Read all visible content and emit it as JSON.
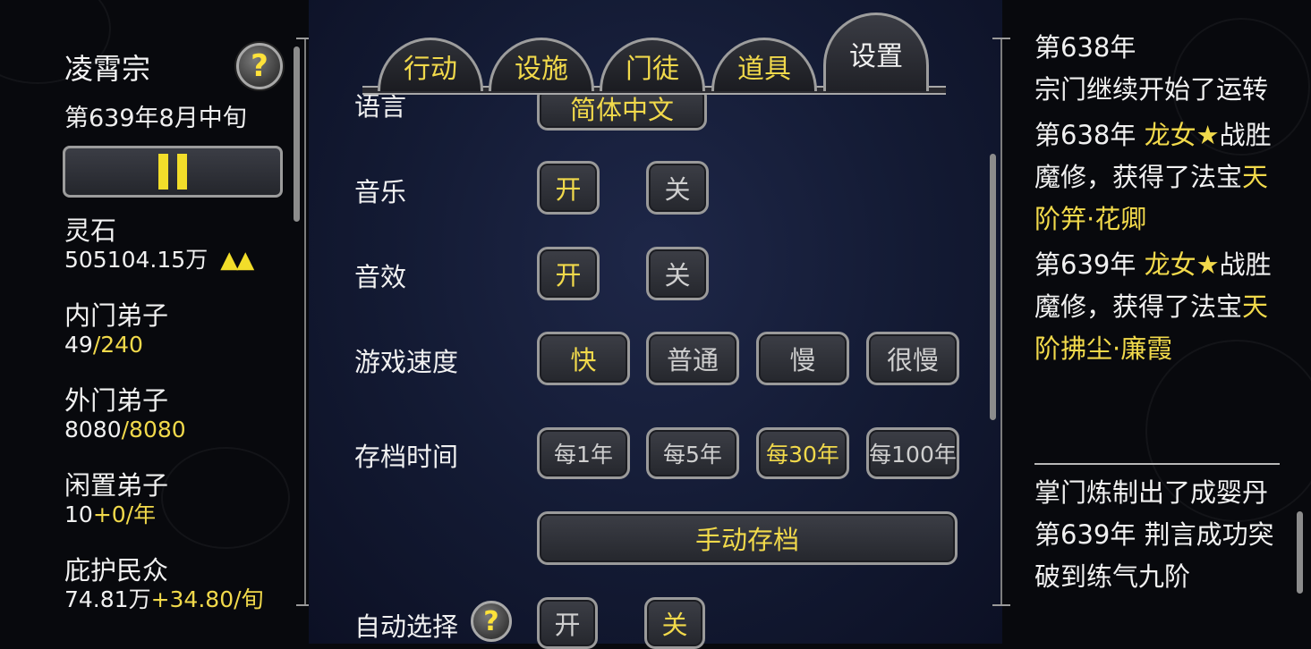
{
  "sidebar": {
    "sect_name": "凌霄宗",
    "date": "第639年8月中旬",
    "help_glyph": "?",
    "stats": [
      {
        "label": "灵石",
        "value": "505104.15万",
        "extra": "",
        "indicator": "▲▲"
      },
      {
        "label": "内门弟子",
        "value": "49",
        "extra": "/240"
      },
      {
        "label": "外门弟子",
        "value": "8080",
        "extra": "/8080"
      },
      {
        "label": "闲置弟子",
        "value": "10",
        "extra": "+0/年"
      },
      {
        "label": "庇护民众",
        "value": "74.81万",
        "extra": "+34.80/旬"
      }
    ]
  },
  "tabs": [
    {
      "label": "行动",
      "active": false
    },
    {
      "label": "设施",
      "active": false
    },
    {
      "label": "门徒",
      "active": false
    },
    {
      "label": "道具",
      "active": false
    },
    {
      "label": "设置",
      "active": true
    }
  ],
  "settings": {
    "language": {
      "label": "语言",
      "value": "简体中文"
    },
    "music": {
      "label": "音乐",
      "on": "开",
      "off": "关",
      "selected": "on"
    },
    "sfx": {
      "label": "音效",
      "on": "开",
      "off": "关",
      "selected": "on"
    },
    "speed": {
      "label": "游戏速度",
      "options": [
        "快",
        "普通",
        "慢",
        "很慢"
      ],
      "selected": 0
    },
    "autosave": {
      "label": "存档时间",
      "options": [
        "每1年",
        "每5年",
        "每30年",
        "每100年"
      ],
      "selected": 2
    },
    "manual_save": "手动存档",
    "auto_select": {
      "label": "自动选择",
      "on": "开",
      "off": "关",
      "selected": "off"
    }
  },
  "log": {
    "entries": [
      {
        "year": "第638年",
        "text": "宗门继续开始了运转"
      },
      {
        "year": "第638年",
        "name": "龙女★",
        "mid": "战胜魔修，获得了法宝",
        "item": "天阶笄·花卿"
      },
      {
        "year": "第639年",
        "name": "龙女★",
        "mid": "战胜魔修，获得了法宝",
        "item": "天阶拂尘·廉霞"
      }
    ],
    "entries2": [
      {
        "text": "掌门炼制出了成婴丹"
      },
      {
        "year": "第639年",
        "name": "荆言",
        "mid": "成功突破到练气九阶"
      }
    ]
  },
  "colors": {
    "accent": "#f1d94b",
    "text": "#f1f1f1",
    "bg": "#08090d",
    "panel": "#131a33"
  }
}
